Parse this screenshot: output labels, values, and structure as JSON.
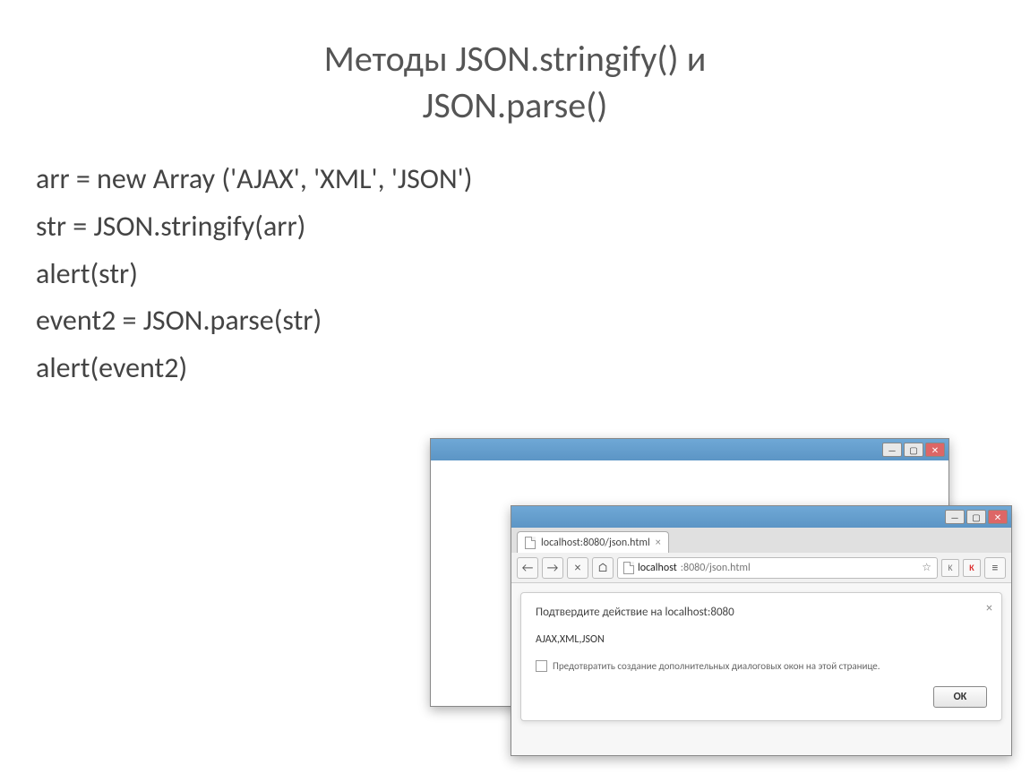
{
  "slide": {
    "title_line1": "Методы JSON.stringify() и",
    "title_line2": "JSON.parse()",
    "code": {
      "line1": "arr = new Array ('AJAX', 'XML', 'JSON')",
      "line2": "str = JSON.stringify(arr)",
      "line3": "alert(str)",
      "line4": "event2 = JSON.parse(str)",
      "line5": "alert(event2)"
    }
  },
  "browser": {
    "tab_title": "localhost:8080/json.html",
    "url_host": "localhost",
    "url_path": ":8080/json.html",
    "dialog": {
      "title": "Подтвердите действие на localhost:8080",
      "message": "AJAX,XML,JSON",
      "checkbox_label": "Предотвратить создание дополнительных диалоговых окон на этой странице.",
      "ok_label": "OK"
    },
    "ext_label_k": "K",
    "ext_label_kaspersky": "K"
  },
  "icons": {
    "minimize": "—",
    "maximize": "▢",
    "close": "✕",
    "back": "←",
    "forward": "→",
    "reload": "×",
    "home": "⌂",
    "star": "☆",
    "menu": "≡",
    "tab_close": "×",
    "dialog_close": "×"
  }
}
